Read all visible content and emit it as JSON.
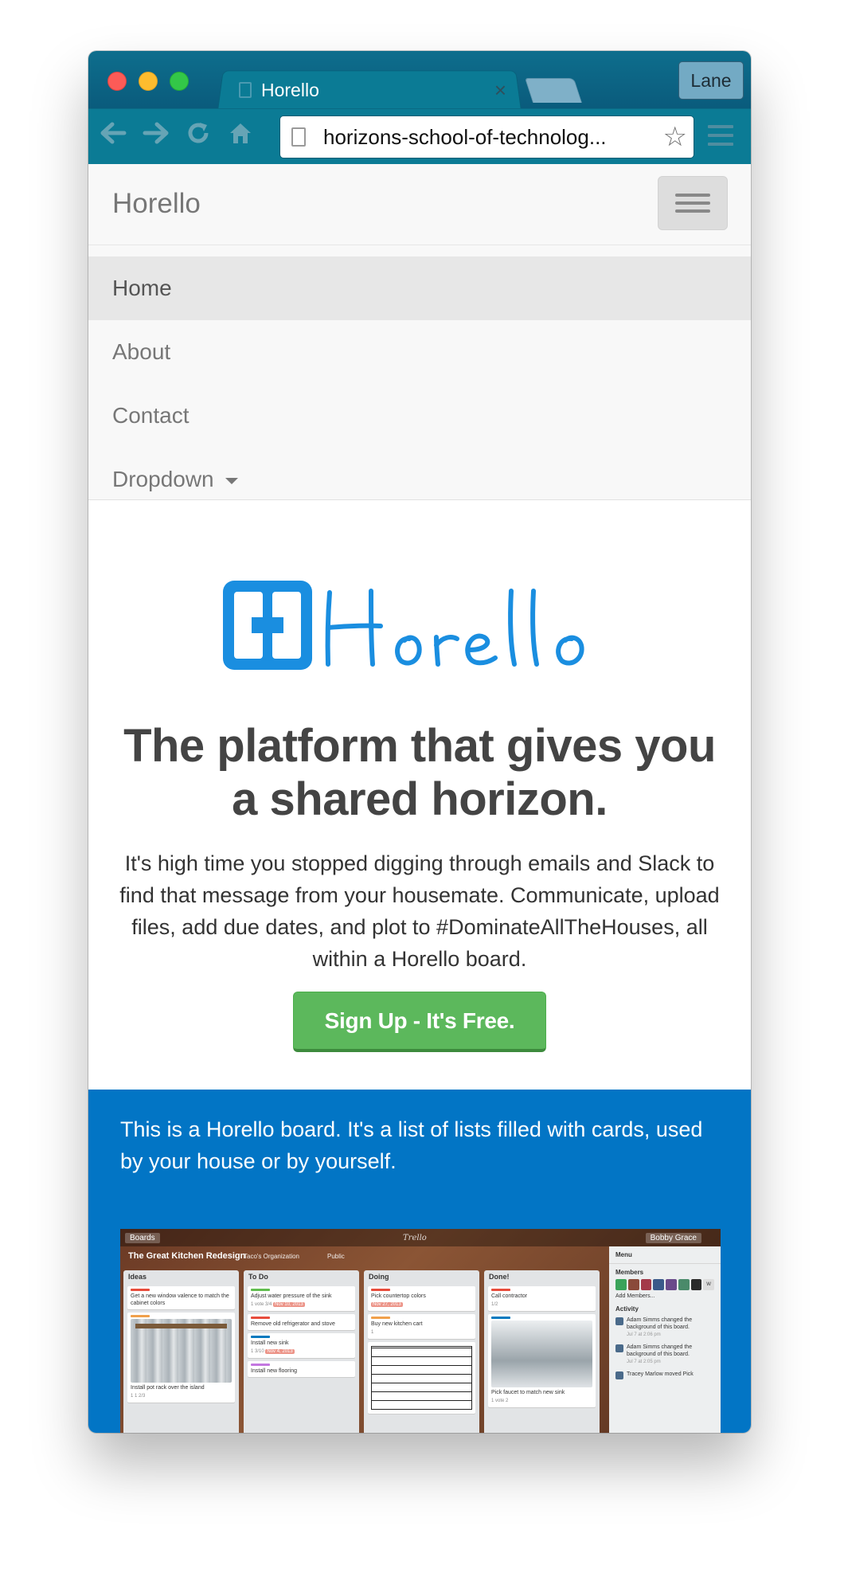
{
  "browser": {
    "tab_title": "Horello",
    "profile_name": "Lane",
    "url": "horizons-school-of-technolog...",
    "icons": {
      "back": "back-arrow-icon",
      "forward": "forward-arrow-icon",
      "reload": "reload-icon",
      "home": "home-icon",
      "bookmark": "star-icon",
      "menu": "hamburger-menu-icon"
    }
  },
  "navbar": {
    "brand": "Horello",
    "items": [
      {
        "label": "Home",
        "active": true
      },
      {
        "label": "About",
        "active": false
      },
      {
        "label": "Contact",
        "active": false
      },
      {
        "label": "Dropdown",
        "active": false
      }
    ]
  },
  "hero": {
    "logo_text": "Horello",
    "headline": "The platform that gives you a shared horizon.",
    "lead": "It's high time you stopped digging through emails and Slack to find that message from your housemate. Communicate, upload files, add due dates, and plot to #DominateAllTheHouses, all within a Horello board.",
    "cta": "Sign Up - It's Free."
  },
  "board_section": {
    "intro": "This is a Horello board. It's a list of lists filled with cards, used by your house or by yourself."
  },
  "board_screenshot": {
    "boards_button": "Boards",
    "center_logo": "Trello",
    "user": "Bobby Grace",
    "title": "The Great Kitchen Redesign",
    "org": "Taco's Organization",
    "visibility": "Public",
    "lists": [
      {
        "name": "Ideas",
        "cards": [
          "Get a new window valence to match the cabinet colors",
          "Install pot rack over the island"
        ]
      },
      {
        "name": "To Do",
        "cards": [
          "Adjust water pressure of the sink",
          "Remove old refrigerator and stove",
          "Install new sink",
          "Install new flooring"
        ]
      },
      {
        "name": "Doing",
        "cards": [
          "Pick countertop colors",
          "Buy new kitchen cart"
        ]
      },
      {
        "name": "Done!",
        "cards": [
          "Call contractor",
          "Pick faucet to match new sink"
        ]
      }
    ],
    "card_meta": {
      "todo_votes": "1 vote",
      "todo_checklist": "3/4",
      "todo_due": "Nov 10, 2013",
      "todo_sink_meta": "1  3/10",
      "todo_sink_due": "Nov 4, 2013",
      "doing_due": "Nov 27, 2013",
      "doing_attach": "1",
      "done_checklist": "1/2",
      "done_votes": "1 vote",
      "done_attach": "2",
      "ideas_meta": "1  1  2/3"
    },
    "menu": {
      "title": "Menu",
      "members_heading": "Members",
      "member_initial": "W",
      "add_members": "Add Members...",
      "activity_heading": "Activity",
      "activity": [
        {
          "text": "Adam Simms changed the background of this board.",
          "time": "Jul 7 at 2:06 pm"
        },
        {
          "text": "Adam Simms changed the background of this board.",
          "time": "Jul 7 at 2:05 pm"
        },
        {
          "text": "Tracey Marlow moved Pick",
          "time": ""
        }
      ]
    }
  },
  "colors": {
    "browser_chrome": "#0b7b95",
    "blue_section": "#0275c5",
    "cta_green": "#5cb85c",
    "logo_blue": "#1a8ee0"
  }
}
